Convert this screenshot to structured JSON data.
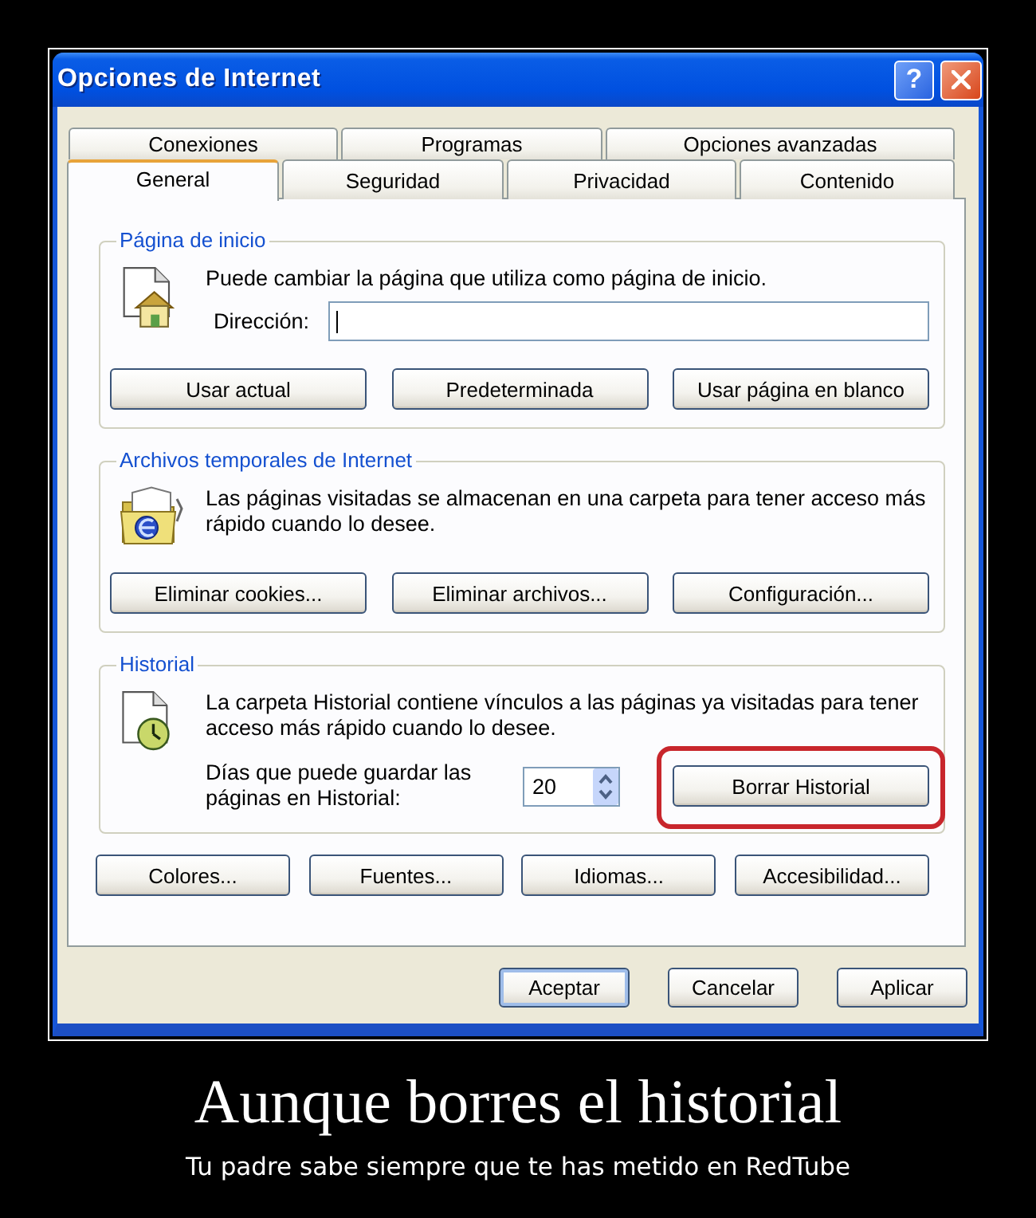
{
  "window": {
    "title": "Opciones de Internet",
    "help_button": "?"
  },
  "tab_rows": [
    {
      "tabs": [
        {
          "label": "Conexiones",
          "selected": false
        },
        {
          "label": "Programas",
          "selected": false
        },
        {
          "label": "Opciones avanzadas",
          "selected": false
        }
      ]
    },
    {
      "tabs": [
        {
          "label": "General",
          "selected": true
        },
        {
          "label": "Seguridad",
          "selected": false
        },
        {
          "label": "Privacidad",
          "selected": false
        },
        {
          "label": "Contenido",
          "selected": false
        }
      ]
    }
  ],
  "groups": [
    {
      "kind": "home",
      "title": "Página de inicio",
      "description": "Puede cambiar la página que utiliza como página de inicio.",
      "address": {
        "label": "Dirección:",
        "focused": true
      },
      "buttons": [
        {
          "label": "Usar actual",
          "highlighted": false
        },
        {
          "label": "Predeterminada",
          "highlighted": false
        },
        {
          "label": "Usar página en blanco",
          "highlighted": false
        }
      ]
    },
    {
      "kind": "temporary_files",
      "title": "Archivos temporales de Internet",
      "description": "Las páginas visitadas se almacenan en una carpeta para tener acceso más rápido cuando lo desee.",
      "buttons": [
        {
          "label": "Eliminar cookies...",
          "highlighted": false
        },
        {
          "label": "Eliminar archivos...",
          "highlighted": false
        },
        {
          "label": "Configuración...",
          "highlighted": false
        }
      ]
    },
    {
      "kind": "history",
      "title": "Historial",
      "description": "La carpeta Historial contiene vínculos a las páginas ya visitadas para tener acceso más rápido cuando lo desee.",
      "days": {
        "label": "Días que puede guardar las páginas en Historial:",
        "value": "20"
      },
      "buttons": [
        {
          "label": "Borrar Historial",
          "highlighted": true
        }
      ]
    }
  ],
  "panel_buttons": [
    "Colores...",
    "Fuentes...",
    "Idiomas...",
    "Accesibilidad..."
  ],
  "dialog_buttons": [
    {
      "label": "Aceptar",
      "default": true
    },
    {
      "label": "Cancelar",
      "default": false
    },
    {
      "label": "Aplicar",
      "default": false
    }
  ],
  "caption": {
    "title": "Aunque borres el historial",
    "subtitle": "Tu padre sabe siempre que te has metido en RedTube"
  }
}
